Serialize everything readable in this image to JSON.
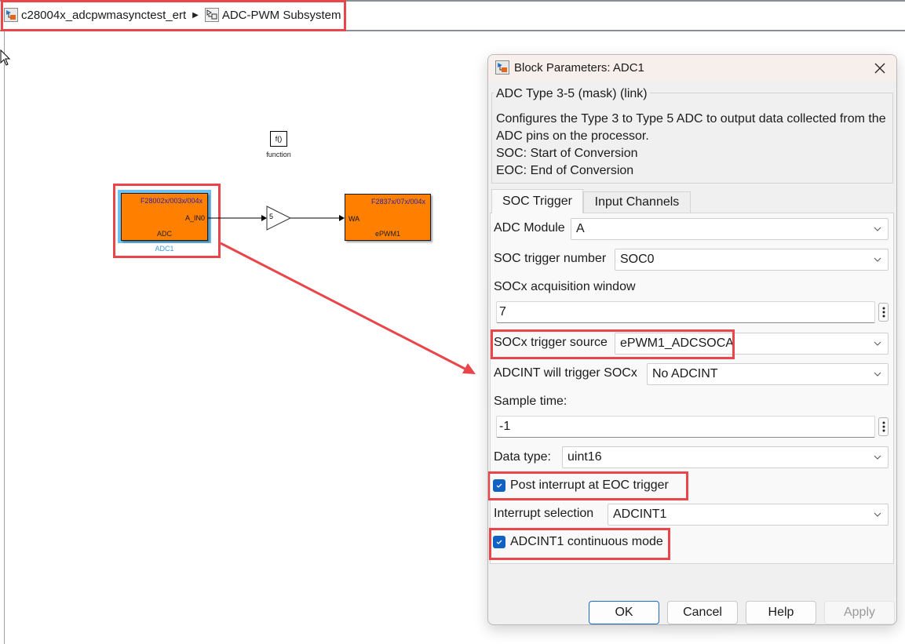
{
  "breadcrumb": {
    "items": [
      {
        "label": "c28004x_adcpwmasynctest_ert",
        "icon": "model-icon"
      },
      {
        "label": "ADC-PWM Subsystem",
        "icon": "subsystem-icon"
      }
    ],
    "separator_icon": "triangle-right-icon"
  },
  "diagram": {
    "function_block": {
      "glyph": "f()",
      "label": "function"
    },
    "adc_block": {
      "family": "F28002x/003x/004x",
      "port_out": "A_IN0",
      "type": "ADC",
      "name": "ADC1"
    },
    "gain_block": {
      "value": "5"
    },
    "pwm_block": {
      "family": "F2837x/07x/004x",
      "port_in": "WA",
      "name": "ePWM1"
    }
  },
  "dialog": {
    "title": "Block Parameters: ADC1",
    "mask_title": "ADC Type 3-5 (mask) (link)",
    "description": [
      "Configures the Type 3 to Type 5 ADC to output data collected from the ADC pins on the processor.",
      "SOC: Start of Conversion",
      "EOC: End of Conversion"
    ],
    "tabs": [
      {
        "label": "SOC Trigger",
        "active": true
      },
      {
        "label": "Input Channels",
        "active": false
      }
    ],
    "fields": {
      "adc_module": {
        "label": "ADC Module",
        "value": "A"
      },
      "soc_trigger_number": {
        "label": "SOC trigger number",
        "value": "SOC0"
      },
      "acquisition_window": {
        "label": "SOCx acquisition window",
        "value": "7"
      },
      "trigger_source": {
        "label": "SOCx trigger source",
        "value": "ePWM1_ADCSOCA"
      },
      "adcint_trigger": {
        "label": "ADCINT will trigger SOCx",
        "value": "No ADCINT"
      },
      "sample_time": {
        "label": "Sample time:",
        "value": "-1"
      },
      "data_type": {
        "label": "Data type:",
        "value": "uint16"
      },
      "post_interrupt": {
        "label": "Post interrupt at EOC trigger",
        "checked": true
      },
      "interrupt_selection": {
        "label": "Interrupt selection",
        "value": "ADCINT1"
      },
      "continuous_mode": {
        "label": "ADCINT1 continuous mode",
        "checked": true
      }
    },
    "buttons": {
      "ok": "OK",
      "cancel": "Cancel",
      "help": "Help",
      "apply": "Apply"
    }
  },
  "colors": {
    "highlight": "#e8464b",
    "block_fill": "#ff8000",
    "selection": "#6ec1f1",
    "checkbox": "#0f62c4"
  }
}
